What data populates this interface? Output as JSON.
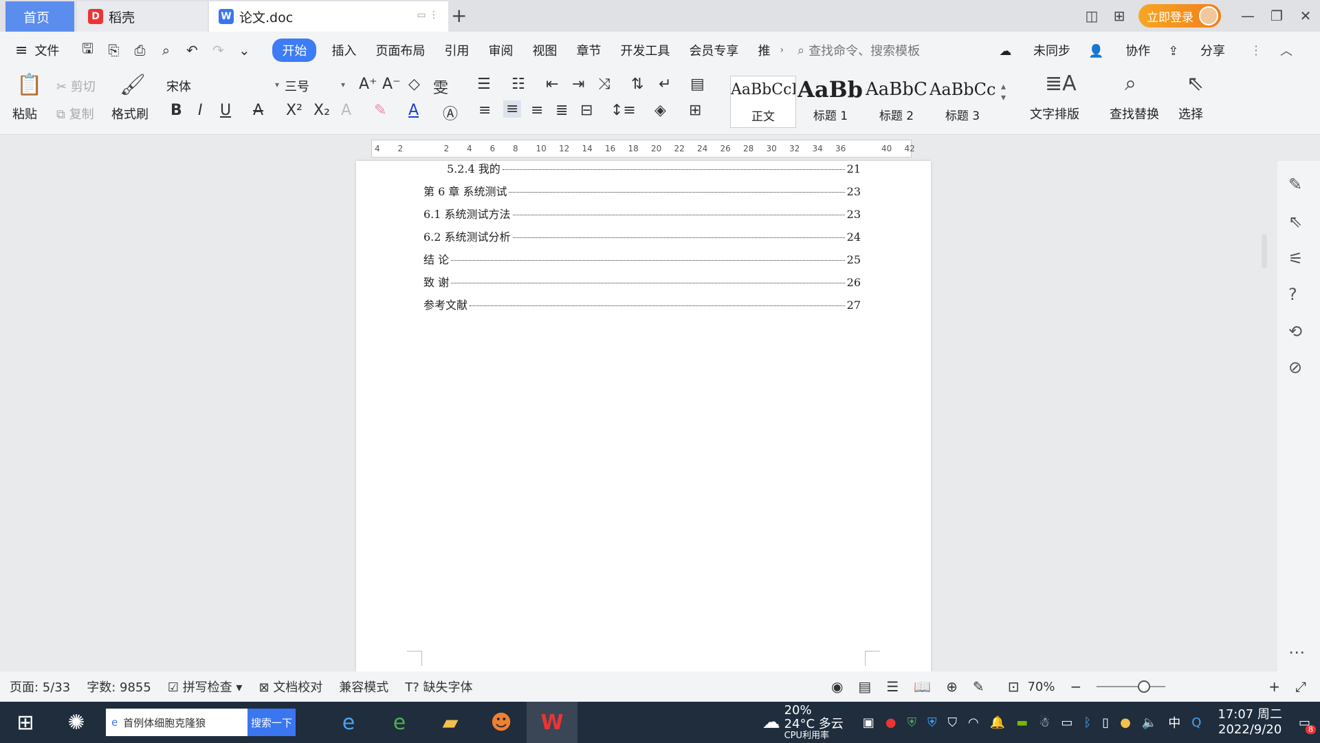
{
  "tabs": {
    "home": "首页",
    "daoke": "稻壳",
    "doc": "论文.doc"
  },
  "login": "立即登录",
  "menu": {
    "file": "文件",
    "items": [
      "开始",
      "插入",
      "页面布局",
      "引用",
      "审阅",
      "视图",
      "章节",
      "开发工具",
      "会员专享",
      "推"
    ],
    "search_placeholder": "查找命令、搜索模板",
    "sync": "未同步",
    "collab": "协作",
    "share": "分享"
  },
  "ribbon": {
    "paste": "粘贴",
    "cut": "剪切",
    "copy": "复制",
    "format_painter": "格式刷",
    "font": "宋体",
    "size": "三号",
    "styles": [
      {
        "sample": "AaBbCcI",
        "label": "正文"
      },
      {
        "sample": "AaBb(",
        "label": "标题 1"
      },
      {
        "sample": "AaBbC",
        "label": "标题 2"
      },
      {
        "sample": "AaBbCc",
        "label": "标题 3"
      }
    ],
    "text_layout": "文字排版",
    "find_replace": "查找替换",
    "select": "选择"
  },
  "ruler_ticks": [
    "4",
    "2",
    "",
    "2",
    "4",
    "6",
    "8",
    "10",
    "12",
    "14",
    "16",
    "18",
    "20",
    "22",
    "24",
    "26",
    "28",
    "30",
    "32",
    "34",
    "36",
    "",
    "40",
    "42"
  ],
  "toc": [
    {
      "title": "5.2.4  我的",
      "page": "21",
      "indent": true
    },
    {
      "title": "第 6 章  系统测试",
      "page": "23",
      "indent": false
    },
    {
      "title": "6.1 系统测试方法",
      "page": "23",
      "indent": false
    },
    {
      "title": "6.2  系统测试分析",
      "page": "24",
      "indent": false
    },
    {
      "title": "结    论",
      "page": "25",
      "indent": false
    },
    {
      "title": "致    谢",
      "page": "26",
      "indent": false
    },
    {
      "title": "参考文献",
      "page": "27",
      "indent": false
    }
  ],
  "status": {
    "page": "页面: 5/33",
    "words": "字数: 9855",
    "spell": "拼写检查",
    "proof": "文档校对",
    "compat": "兼容模式",
    "missing_font": "缺失字体",
    "zoom": "70%"
  },
  "taskbar": {
    "search_text": "首例体细胞克隆狼",
    "search_btn": "搜索一下",
    "weather_temp": "24°C 多云",
    "cpu": "20%",
    "cpu_label": "CPU利用率",
    "ime": "中",
    "time": "17:07 周二",
    "date": "2022/9/20",
    "notif_count": "8"
  }
}
